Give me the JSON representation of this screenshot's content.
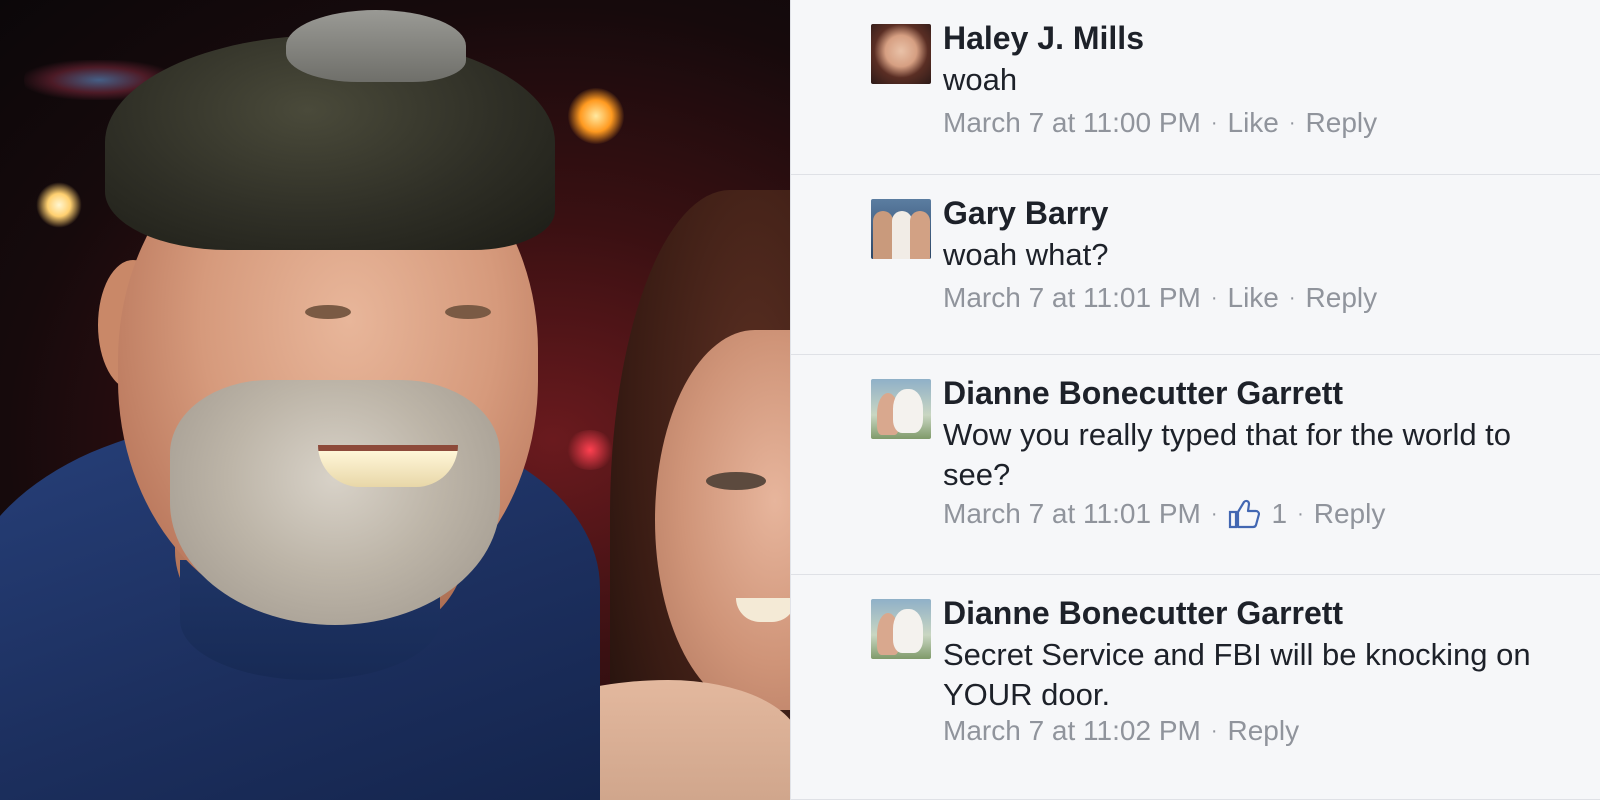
{
  "comments": [
    {
      "author": "Haley J. Mills",
      "text": "woah",
      "timestamp": "March 7 at 11:00 PM",
      "like_label": "Like",
      "reply_label": "Reply"
    },
    {
      "author": "Gary Barry",
      "text": "woah what?",
      "timestamp": "March 7 at 11:01 PM",
      "like_label": "Like",
      "reply_label": "Reply"
    },
    {
      "author": "Dianne Bonecutter Garrett",
      "text": "Wow you really typed that for the world to see?",
      "timestamp": "March 7 at 11:01 PM",
      "like_count": "1",
      "reply_label": "Reply",
      "like_icon": "thumbs-up-icon"
    },
    {
      "author": "Dianne Bonecutter Garrett",
      "text": "Secret Service and FBI will be knocking on YOUR door.",
      "timestamp": "March 7 at 11:02 PM",
      "reply_label": "Reply"
    }
  ],
  "colors": {
    "panel_bg": "#f6f7f9",
    "name": "#1d2129",
    "meta": "#90949c",
    "like_icon": "#4267b2"
  }
}
